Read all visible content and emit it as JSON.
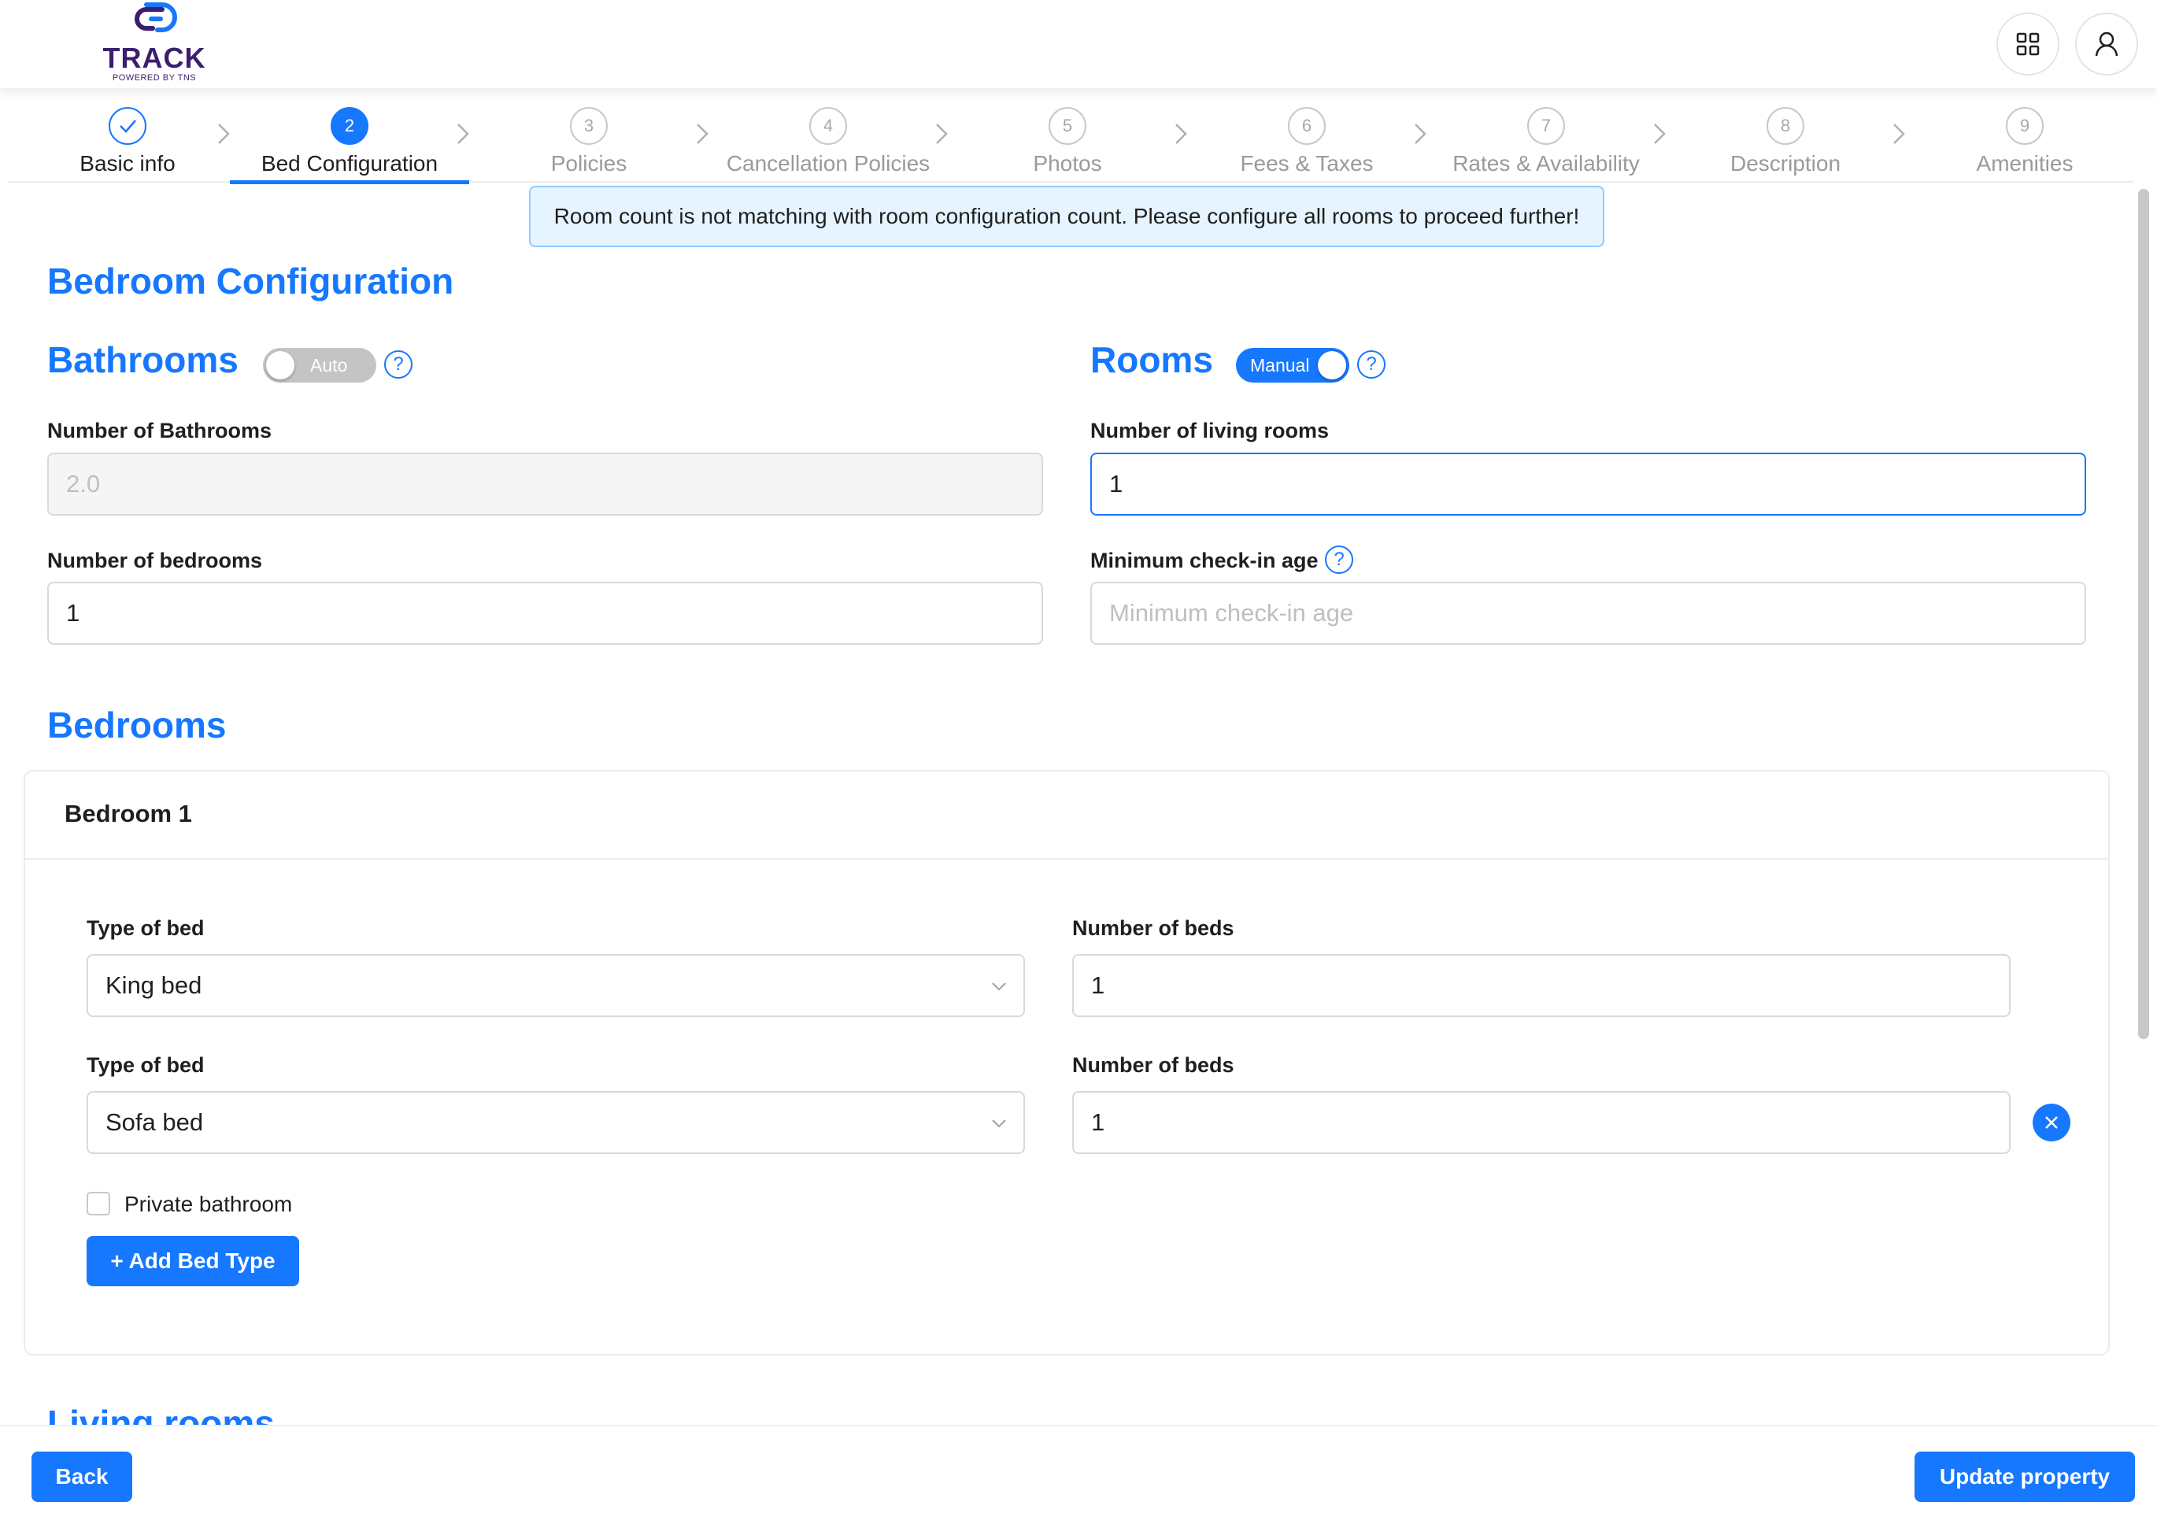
{
  "brand": {
    "name": "TRACK",
    "tagline": "POWERED BY TNS",
    "accent": "#1677ff",
    "logo_color": "#3b1e6e"
  },
  "header": {
    "apps_icon": "grid-icon",
    "user_icon": "user-icon"
  },
  "stepper": {
    "steps": [
      {
        "number": "1",
        "label": "Basic info",
        "state": "done"
      },
      {
        "number": "2",
        "label": "Bed Configuration",
        "state": "active"
      },
      {
        "number": "3",
        "label": "Policies",
        "state": "pending"
      },
      {
        "number": "4",
        "label": "Cancellation Policies",
        "state": "pending"
      },
      {
        "number": "5",
        "label": "Photos",
        "state": "pending"
      },
      {
        "number": "6",
        "label": "Fees & Taxes",
        "state": "pending"
      },
      {
        "number": "7",
        "label": "Rates & Availability",
        "state": "pending"
      },
      {
        "number": "8",
        "label": "Description",
        "state": "pending"
      },
      {
        "number": "9",
        "label": "Amenities",
        "state": "pending"
      }
    ]
  },
  "alert": {
    "message": "Room count is not matching with room configuration count. Please configure all rooms to proceed further!"
  },
  "page_title": "Bedroom Configuration",
  "bathrooms": {
    "heading": "Bathrooms",
    "toggle_label": "Auto",
    "toggle_on": false,
    "fields": {
      "bathrooms_label": "Number of Bathrooms",
      "bathrooms_value": "2.0",
      "bedrooms_label": "Number of bedrooms",
      "bedrooms_value": "1"
    }
  },
  "rooms": {
    "heading": "Rooms",
    "toggle_label": "Manual",
    "toggle_on": true,
    "fields": {
      "living_rooms_label": "Number of living rooms",
      "living_rooms_value": "1",
      "checkin_age_label": "Minimum check-in age",
      "checkin_age_placeholder": "Minimum check-in age"
    }
  },
  "help_glyph": "?",
  "bedrooms_section": {
    "heading": "Bedrooms",
    "bedroom": {
      "title": "Bedroom 1",
      "beds": [
        {
          "type_label": "Type of bed",
          "type_value": "King bed",
          "count_label": "Number of beds",
          "count_value": "1",
          "removable": false
        },
        {
          "type_label": "Type of bed",
          "type_value": "Sofa bed",
          "count_label": "Number of beds",
          "count_value": "1",
          "removable": true
        }
      ],
      "private_bathroom_label": "Private bathroom",
      "private_bathroom_checked": false,
      "add_bed_label": "+ Add Bed Type"
    }
  },
  "living_rooms_heading": "Living rooms",
  "footer": {
    "back_label": "Back",
    "update_label": "Update property"
  }
}
